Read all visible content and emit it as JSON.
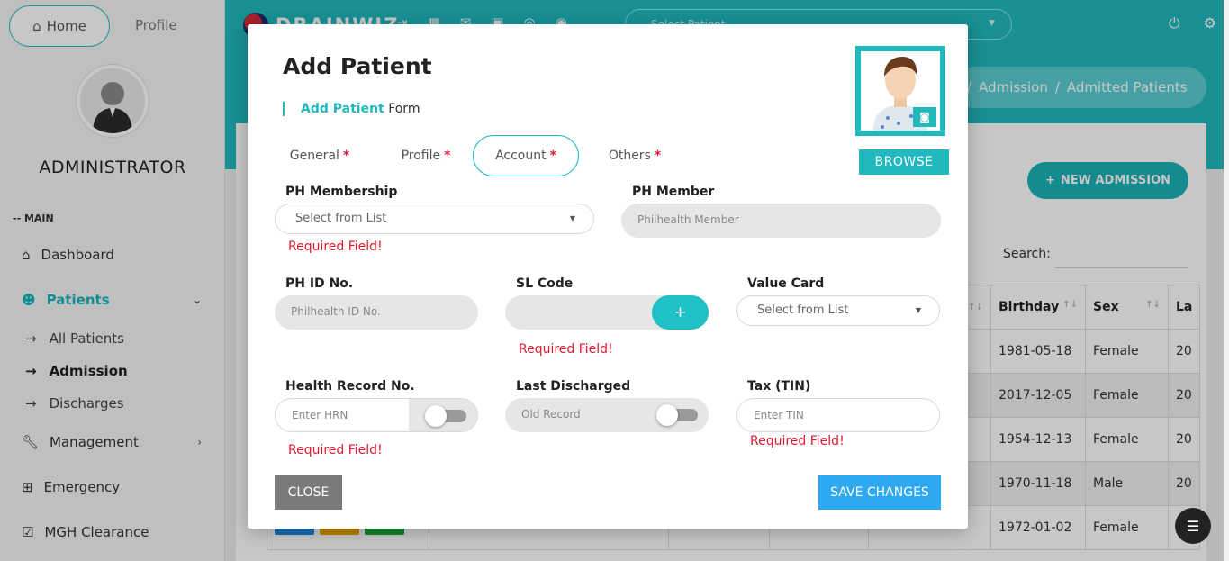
{
  "sidebar": {
    "home_label": "Home",
    "profile_label": "Profile",
    "admin_name": "ADMINISTRATOR",
    "section_label": "-- MAIN",
    "items": [
      {
        "label": "Dashboard",
        "icon": "home-icon"
      },
      {
        "label": "Patients",
        "icon": "patient-icon"
      },
      {
        "label": "Management",
        "icon": "wrench-icon"
      },
      {
        "label": "Emergency",
        "icon": "plus-square-icon"
      },
      {
        "label": "MGH Clearance",
        "icon": "checkbox-icon"
      }
    ],
    "sub_items": [
      "All Patients",
      "Admission",
      "Discharges"
    ]
  },
  "topbar": {
    "brand": "DRAINWIZ",
    "select_placeholder": "Select Patient"
  },
  "page": {
    "breadcrumb": [
      "Admission",
      "Admitted Patients"
    ],
    "new_admission_label": "NEW ADMISSION",
    "search_label": "Search:",
    "table": {
      "headers": [
        "Birthday",
        "Sex",
        "La"
      ],
      "rows": [
        {
          "birthday": "1981-05-18",
          "sex": "Female",
          "last": "20"
        },
        {
          "birthday": "2017-12-05",
          "sex": "Female",
          "last": "20"
        },
        {
          "birthday": "1954-12-13",
          "sex": "Female",
          "last": "20"
        },
        {
          "birthday": "1970-11-18",
          "sex": "Male",
          "last": "20"
        },
        {
          "birthday": "1972-01-02",
          "sex": "Female",
          "last": "20"
        }
      ]
    }
  },
  "modal": {
    "title": "Add Patient",
    "subtitle_accent": "Add Patient",
    "subtitle_rest": "Form",
    "browse_label": "BROWSE",
    "tabs": [
      "General",
      "Profile",
      "Account",
      "Others"
    ],
    "required_mark": "*",
    "fields": {
      "ph_membership": {
        "label": "PH Membership",
        "placeholder": "Select from List",
        "error": "Required Field!"
      },
      "ph_member": {
        "label": "PH Member",
        "placeholder": "Philhealth Member"
      },
      "ph_id": {
        "label": "PH ID No.",
        "placeholder": "Philhealth ID No."
      },
      "sl_code": {
        "label": "SL Code",
        "button": "+",
        "error": "Required Field!"
      },
      "value_card": {
        "label": "Value Card",
        "placeholder": "Select from List"
      },
      "hrn": {
        "label": "Health Record No.",
        "placeholder": "Enter HRN",
        "error": "Required Field!"
      },
      "last_discharged": {
        "label": "Last Discharged",
        "placeholder": "Old Record"
      },
      "tin": {
        "label": "Tax (TIN)",
        "placeholder": "Enter TIN",
        "error": "Required Field!"
      }
    },
    "close_label": "CLOSE",
    "save_label": "SAVE CHANGES"
  },
  "colors": {
    "accent": "#1fb9be",
    "error": "#e0192d",
    "save": "#2ea8f0",
    "close": "#7a7a7a"
  }
}
